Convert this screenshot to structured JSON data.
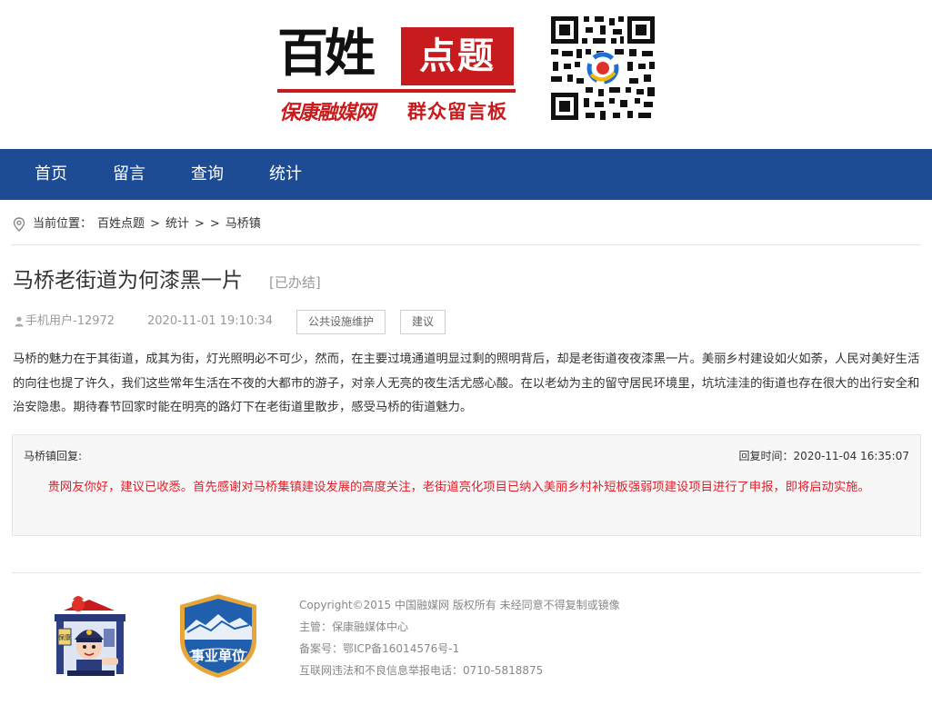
{
  "header": {
    "logo_big": "百姓",
    "logo_box": "点题",
    "logo_sub_left": "保康融媒网",
    "logo_sub_right": "群众留言板"
  },
  "nav": {
    "items": [
      {
        "label": "首页"
      },
      {
        "label": "留言"
      },
      {
        "label": "查询"
      },
      {
        "label": "统计"
      }
    ]
  },
  "breadcrumb": {
    "prefix": "当前位置：",
    "items": [
      "百姓点题",
      "统计",
      "",
      "马桥镇"
    ],
    "sep": ">"
  },
  "article": {
    "title": "马桥老街道为何漆黑一片",
    "status": "[已办结]",
    "user": "手机用户-12972",
    "time": "2020-11-01 19:10:34",
    "tags": [
      "公共设施维护",
      "建议"
    ],
    "body": "马桥的魅力在于其街道，成其为街，灯光照明必不可少，然而，在主要过境通道明显过剩的照明背后，却是老街道夜夜漆黑一片。美丽乡村建设如火如荼，人民对美好生活的向往也提了许久，我们这些常年生活在不夜的大都市的游子，对亲人无亮的夜生活尤感心酸。在以老幼为主的留守居民环境里，坑坑洼洼的街道也存在很大的出行安全和治安隐患。期待春节回家时能在明亮的路灯下在老街道里散步，感受马桥的街道魅力。"
  },
  "reply": {
    "from": "马桥镇回复:",
    "time_label": "回复时间：2020-11-04 16:35:07",
    "text": "贵网友你好，建议已收悉。首先感谢对马桥集镇建设发展的高度关注，老街道亮化项目已纳入美丽乡村补短板强弱项建设项目进行了申报，即将启动实施。"
  },
  "footer": {
    "badge_text": "事业单位",
    "police_box_text": "保康",
    "lines": [
      "Copyright©2015 中国融媒网 版权所有 未经同意不得复制或镜像",
      "主管：保康融媒体中心",
      "备案号：鄂ICP备16014576号-1",
      "互联网违法和不良信息举报电话：0710-5818875"
    ]
  },
  "colors": {
    "nav_bg": "#1d4b94",
    "brand_red": "#c81b1d",
    "reply_red": "#e0202a"
  }
}
